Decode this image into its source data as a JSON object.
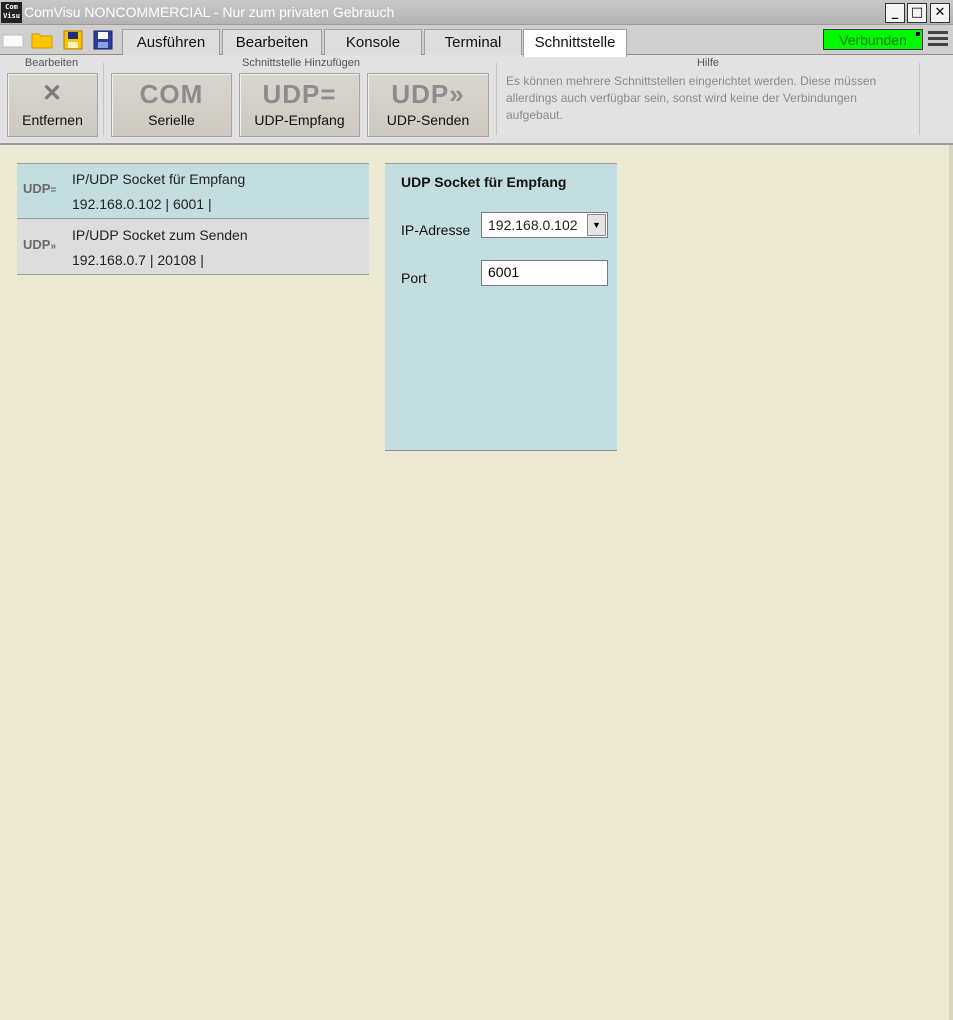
{
  "window": {
    "logo_text": "Com Visu",
    "title": "ComVisu NONCOMMERCIAL - Nur zum privaten Gebrauch",
    "minimize": "_",
    "maximize": "□",
    "close": "✕"
  },
  "menubar": {
    "tabs": [
      {
        "label": "Ausführen"
      },
      {
        "label": "Bearbeiten"
      },
      {
        "label": "Konsole"
      },
      {
        "label": "Terminal"
      },
      {
        "label": "Schnittstelle",
        "active": true
      }
    ],
    "status": "Verbunden",
    "quick_icons": [
      "new-file-icon",
      "open-folder-icon",
      "save-icon",
      "save-as-icon"
    ],
    "status_color": "#00F800"
  },
  "ribbon": {
    "group_edit": "Bearbeiten",
    "group_add": "Schnittstelle Hinzufügen",
    "group_help": "Hilfe",
    "remove_icon": "✕",
    "remove_label": "Entfernen",
    "serial_icon": "COM",
    "serial_label": "Serielle",
    "udp_recv_icon": "UDP=",
    "udp_recv_label": "UDP-Empfang",
    "udp_send_icon": "UDP»",
    "udp_send_label": "UDP-Senden",
    "help_text": "Es können mehrere Schnittstellen eingerichtet werden. Diese müssen allerdings auch verfügbar sein, sonst wird keine der Verbindungen aufgebaut."
  },
  "interfaces": [
    {
      "icon_main": "UDP",
      "icon_suffix": "=",
      "title": "IP/UDP Socket für Empfang",
      "detail": "192.168.0.102 | 6001 |",
      "selected": true
    },
    {
      "icon_main": "UDP",
      "icon_suffix": "»",
      "title": "IP/UDP Socket zum Senden",
      "detail": "192.168.0.7 | 20108 |",
      "selected": false
    }
  ],
  "properties": {
    "title": "UDP Socket für Empfang",
    "ip_label": "IP-Adresse",
    "ip_value": "192.168.0.102",
    "port_label": "Port",
    "port_value": "6001"
  },
  "colors": {
    "background": "#ECE9D3",
    "selected": "#C4DDE1"
  }
}
